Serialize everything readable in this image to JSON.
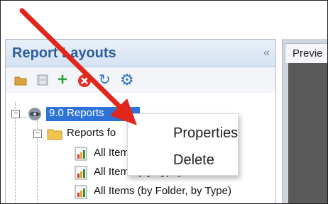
{
  "panel": {
    "title": "Report Layouts",
    "collapse_glyph": "«"
  },
  "toolbar": {
    "icons": [
      "folder-icon",
      "save-icon",
      "add-icon",
      "delete-icon",
      "refresh-icon",
      "gear-icon"
    ],
    "add_glyph": "+",
    "refresh_glyph": "↻",
    "gear_glyph": "⚙"
  },
  "tree": {
    "root": "9.0 Reports",
    "folder": "Reports fo",
    "items": [
      "All Item",
      "All Items (by Type)",
      "All Items (by Folder, by Type)"
    ]
  },
  "preview": {
    "tab_label": "Previe"
  },
  "context_menu": {
    "items": [
      "Properties",
      "Delete"
    ]
  },
  "colors": {
    "accent": "#2e74d8",
    "header_text": "#2f5f9a",
    "arrow": "#e1261c"
  }
}
